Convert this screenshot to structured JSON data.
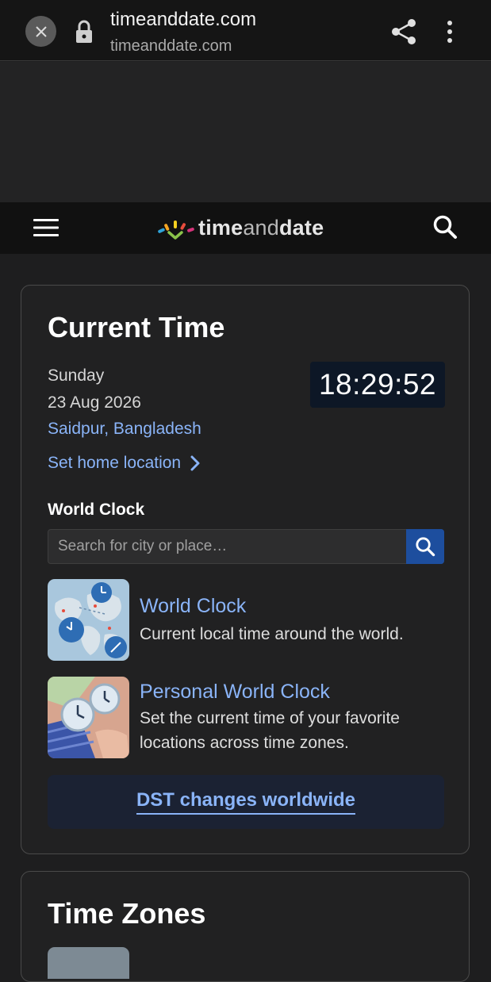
{
  "browser": {
    "title": "timeanddate.com",
    "url": "timeanddate.com",
    "icons": [
      "close-icon",
      "lock-icon",
      "share-icon",
      "more-vert-icon"
    ]
  },
  "site_header": {
    "logo_bold": "time",
    "logo_light": "and",
    "logo_bold2": "date",
    "icons": [
      "hamburger-menu-icon",
      "search-icon"
    ]
  },
  "current_time": {
    "heading": "Current Time",
    "day": "Sunday",
    "date": "23 Aug 2026",
    "location": "Saidpur, Bangladesh",
    "set_home": "Set home location",
    "clock": "18:29:52"
  },
  "world_clock": {
    "heading": "World Clock",
    "search_placeholder": "Search for city or place…",
    "items": [
      {
        "title": "World Clock",
        "desc": "Current local time around the world."
      },
      {
        "title": "Personal World Clock",
        "desc": "Set the current time of your favorite locations across time zones."
      }
    ],
    "dst_link": "DST changes worldwide"
  },
  "time_zones": {
    "heading": "Time Zones"
  },
  "colors": {
    "link": "#8ab4f8",
    "search_button": "#1d4e9e",
    "clock_bg": "#0d1726"
  }
}
